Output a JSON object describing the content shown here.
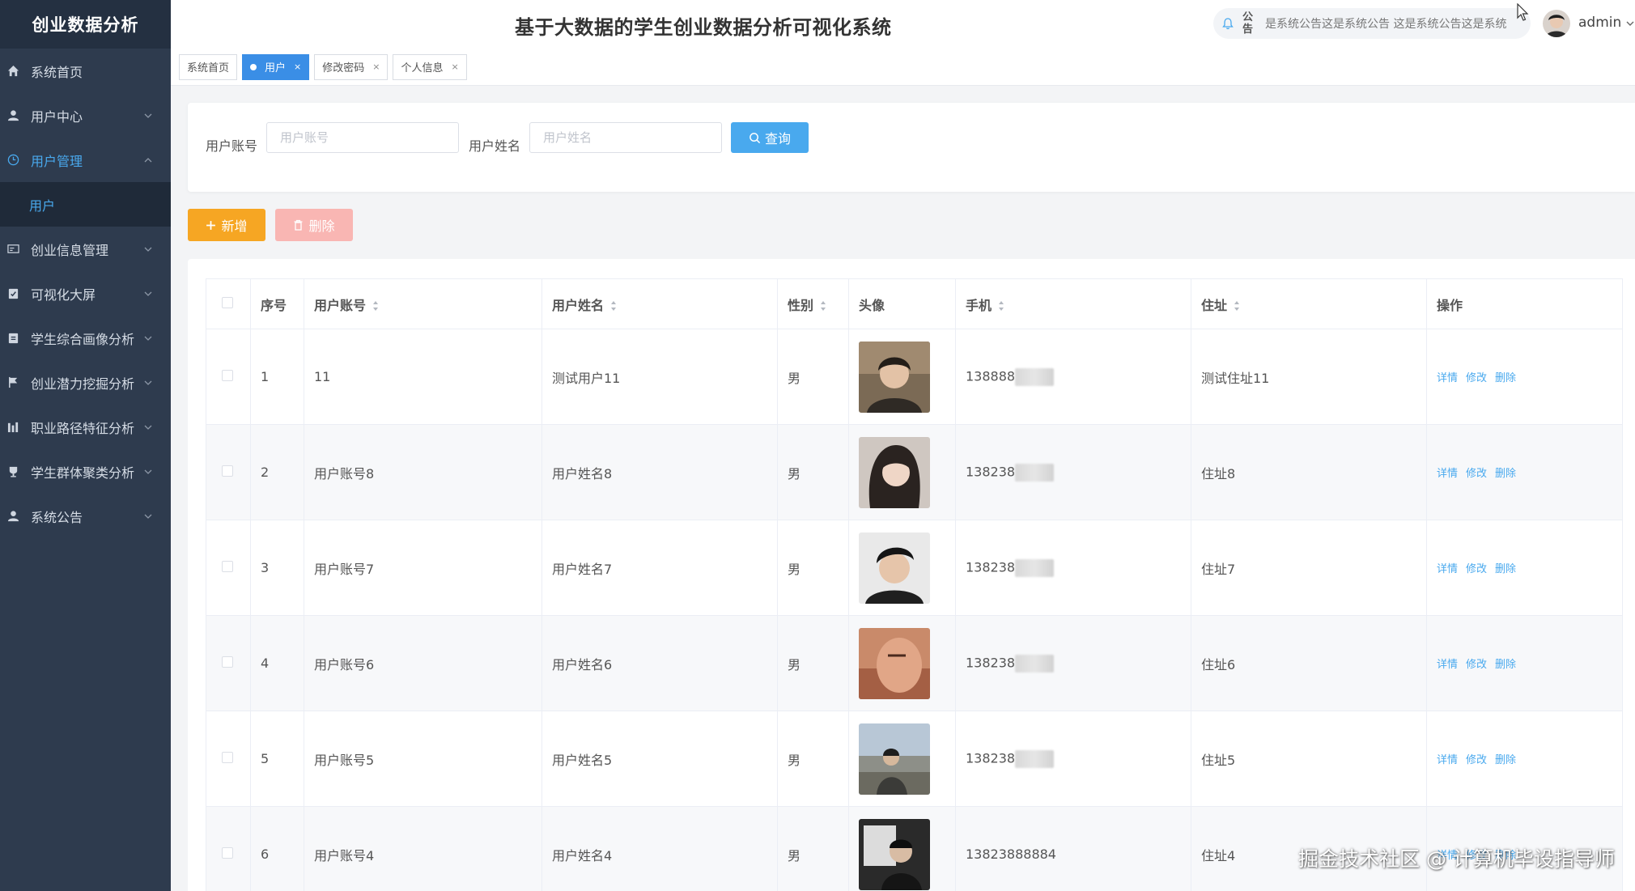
{
  "sidebar": {
    "brand": "创业数据分析",
    "items": [
      {
        "label": "系统首页",
        "icon": "home-icon"
      },
      {
        "label": "用户中心",
        "icon": "user-icon"
      },
      {
        "label": "用户管理",
        "icon": "clock-icon",
        "expanded": true,
        "children": [
          {
            "label": "用户"
          }
        ]
      },
      {
        "label": "创业信息管理",
        "icon": "card-icon"
      },
      {
        "label": "可视化大屏",
        "icon": "clipboard-check-icon"
      },
      {
        "label": "学生综合画像分析",
        "icon": "clipboard-icon"
      },
      {
        "label": "创业潜力挖掘分析",
        "icon": "flag-icon"
      },
      {
        "label": "职业路径特征分析",
        "icon": "bar-chart-icon"
      },
      {
        "label": "学生群体聚类分析",
        "icon": "trophy-icon"
      },
      {
        "label": "系统公告",
        "icon": "user-icon"
      }
    ]
  },
  "header": {
    "title": "基于大数据的学生创业数据分析可视化系统",
    "notice_label": "公告",
    "notice_text": "是系统公告这是系统公告    这是系统公告这是系统",
    "username": "admin"
  },
  "tabs": [
    {
      "label": "系统首页",
      "active": false,
      "closable": false
    },
    {
      "label": "用户",
      "active": true,
      "closable": true
    },
    {
      "label": "修改密码",
      "active": false,
      "closable": true
    },
    {
      "label": "个人信息",
      "active": false,
      "closable": true
    }
  ],
  "search": {
    "account_label": "用户账号",
    "account_placeholder": "用户账号",
    "name_label": "用户姓名",
    "name_placeholder": "用户姓名",
    "query_label": "查询"
  },
  "actions": {
    "add_label": "新增",
    "delete_label": "删除"
  },
  "table": {
    "headers": [
      "序号",
      "用户账号",
      "用户姓名",
      "性别",
      "头像",
      "手机",
      "住址",
      "操作"
    ],
    "rows": [
      {
        "no": "1",
        "account": "11",
        "name": "测试用户11",
        "gender": "男",
        "phone": "138888",
        "phone_masked": true,
        "address": "测试住址11"
      },
      {
        "no": "2",
        "account": "用户账号8",
        "name": "用户姓名8",
        "gender": "男",
        "phone": "138238",
        "phone_masked": true,
        "address": "住址8"
      },
      {
        "no": "3",
        "account": "用户账号7",
        "name": "用户姓名7",
        "gender": "男",
        "phone": "138238",
        "phone_masked": true,
        "address": "住址7"
      },
      {
        "no": "4",
        "account": "用户账号6",
        "name": "用户姓名6",
        "gender": "男",
        "phone": "138238",
        "phone_masked": true,
        "address": "住址6"
      },
      {
        "no": "5",
        "account": "用户账号5",
        "name": "用户姓名5",
        "gender": "男",
        "phone": "138238",
        "phone_masked": true,
        "address": "住址5"
      },
      {
        "no": "6",
        "account": "用户账号4",
        "name": "用户姓名4",
        "gender": "男",
        "phone": "13823888884",
        "phone_masked": false,
        "address": "住址4"
      }
    ],
    "ops": [
      "详情",
      "修改",
      "删除"
    ]
  },
  "watermark": "掘金技术社区 @ 计算机毕设指导师",
  "colors": {
    "sidebar_bg": "#2e3b4e",
    "accent": "#49a9ee",
    "add": "#f6a623",
    "delete": "#f9b6b3"
  }
}
